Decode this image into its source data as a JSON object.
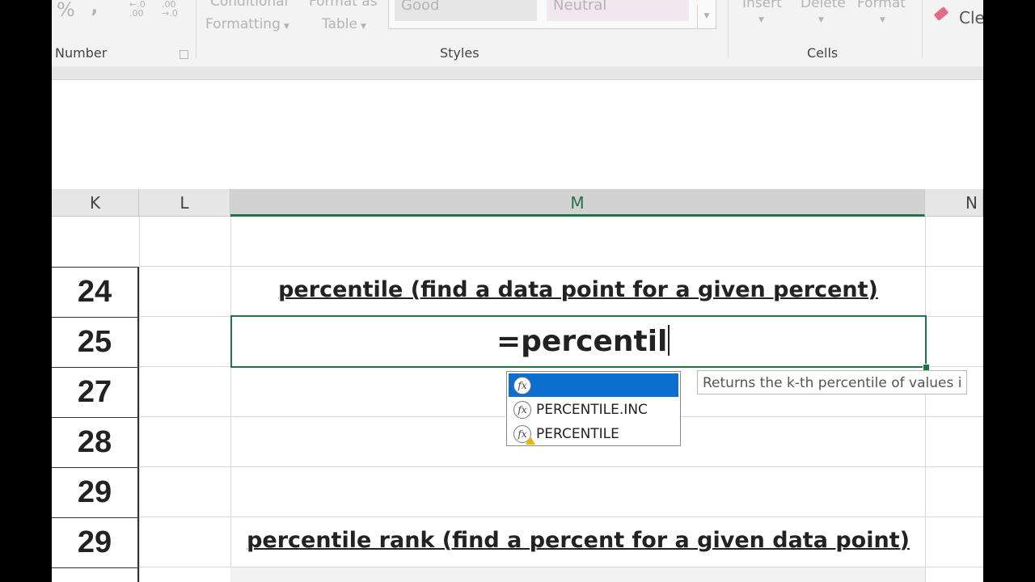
{
  "ribbon": {
    "number_group": {
      "percent_symbol": "%",
      "comma_symbol": "‚",
      "increase_decimal": "←.0 .00",
      "decrease_decimal": ".00 →.0",
      "label": "Number"
    },
    "styles_group": {
      "conditional_formatting_line1": "Conditional",
      "conditional_formatting_line2": "Formatting",
      "format_as_table_line1": "Format as",
      "format_as_table_line2": "Table",
      "style_good": "Good",
      "style_neutral": "Neutral",
      "label": "Styles"
    },
    "cells_group": {
      "insert": "Insert",
      "delete": "Delete",
      "format": "Format",
      "label": "Cells"
    },
    "editing_group": {
      "clear_partial": "Cle"
    }
  },
  "columns": [
    "K",
    "L",
    "M",
    "N"
  ],
  "selected_column": "M",
  "rows": [
    {
      "number": "",
      "m_text": ""
    },
    {
      "number": "24",
      "m_text": "percentile (find a data point for a given percent)"
    },
    {
      "number": "25",
      "m_text": "=percentil"
    },
    {
      "number": "27",
      "m_text": ""
    },
    {
      "number": "28",
      "m_text": ""
    },
    {
      "number": "29",
      "m_text": ""
    },
    {
      "number": "29",
      "m_text": "percentile rank (find a percent for a given data point)"
    }
  ],
  "autocomplete": {
    "items": [
      {
        "label": "",
        "icon": "function-icon",
        "selected": true
      },
      {
        "label": "PERCENTILE.INC",
        "icon": "function-icon",
        "selected": false
      },
      {
        "label": "PERCENTILE",
        "icon": "function-warning-icon",
        "selected": false
      }
    ],
    "tooltip": "Returns the k-th percentile of values i"
  },
  "colors": {
    "accent_green": "#217346",
    "selection_blue": "#0b6fd0"
  }
}
